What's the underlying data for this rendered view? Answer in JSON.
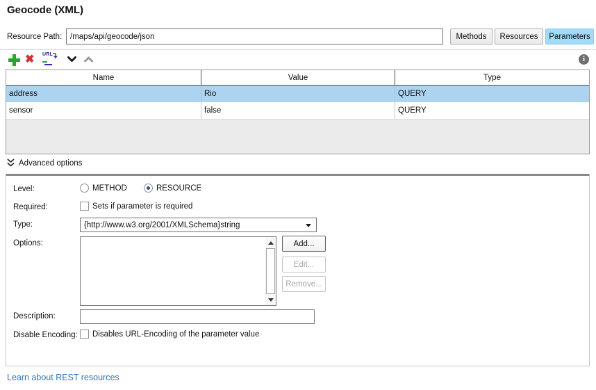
{
  "page": {
    "title": "Geocode (XML)"
  },
  "resource_path": {
    "label": "Resource Path:",
    "value": "/maps/api/geocode/json"
  },
  "tabs": [
    {
      "label": "Methods",
      "active": false
    },
    {
      "label": "Resources",
      "active": false
    },
    {
      "label": "Parameters",
      "active": true
    }
  ],
  "toolbar": {
    "url_icon_text": "URL",
    "icons": [
      "add-parameter-icon",
      "delete-parameter-icon",
      "extract-params-from-url-icon",
      "move-down-icon",
      "move-up-icon",
      "info-icon"
    ],
    "info_icon_text": "i"
  },
  "params_table": {
    "columns": [
      "Name",
      "Value",
      "Type"
    ],
    "rows": [
      {
        "name": "address",
        "value": "Rio",
        "type": "QUERY",
        "selected": true
      },
      {
        "name": "sensor",
        "value": "false",
        "type": "QUERY",
        "selected": false
      }
    ]
  },
  "advanced": {
    "toggle_label": "Advanced options",
    "level": {
      "label": "Level:",
      "options": [
        {
          "label": "METHOD",
          "selected": false
        },
        {
          "label": "RESOURCE",
          "selected": true
        }
      ]
    },
    "required": {
      "label": "Required:",
      "checkbox_label": "Sets if parameter is required",
      "checked": false
    },
    "type": {
      "label": "Type:",
      "value": "{http://www.w3.org/2001/XMLSchema}string"
    },
    "options": {
      "label": "Options:",
      "items": [],
      "buttons": [
        {
          "label": "Add...",
          "enabled": true
        },
        {
          "label": "Edit...",
          "enabled": false
        },
        {
          "label": "Remove...",
          "enabled": false
        }
      ]
    },
    "description": {
      "label": "Description:",
      "value": ""
    },
    "disable_encoding": {
      "label": "Disable Encoding:",
      "checkbox_label": "Disables URL-Encoding of the parameter value",
      "checked": false
    }
  },
  "footer": {
    "link_label": "Learn about REST resources"
  },
  "colors": {
    "tab_active_blue": "#A3DAF7",
    "row_selection_blue": "#ACD3EF",
    "link_blue": "#2E75B6",
    "add_green": "#2CA32C",
    "delete_red": "#CE3030",
    "panel_border_gray": "#8A8A8A",
    "table_filler_gray": "#EBEBEB"
  }
}
